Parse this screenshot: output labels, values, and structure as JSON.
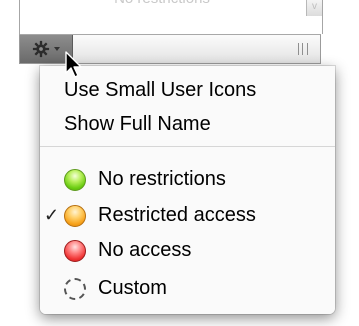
{
  "list": {
    "faded_row_text": "No restrictions",
    "scroll_arrow": "v"
  },
  "toolbar": {
    "gear_icon": "gear-icon",
    "gear_menu_caret": "chevron-down-icon",
    "resize_grip": "resize-grip-icon"
  },
  "menu": {
    "top_items": [
      {
        "label": "Use Small User Icons"
      },
      {
        "label": "Show Full Name"
      }
    ],
    "access_items": [
      {
        "label": "No restrictions",
        "color": "#6ccd12",
        "checked": false
      },
      {
        "label": "Restricted access",
        "color": "#f7a21b",
        "checked": true
      },
      {
        "label": "No access",
        "color": "#f03535",
        "checked": false
      },
      {
        "label": "Custom",
        "color": "#555555",
        "checked": false
      }
    ],
    "check_glyph": "✓"
  }
}
